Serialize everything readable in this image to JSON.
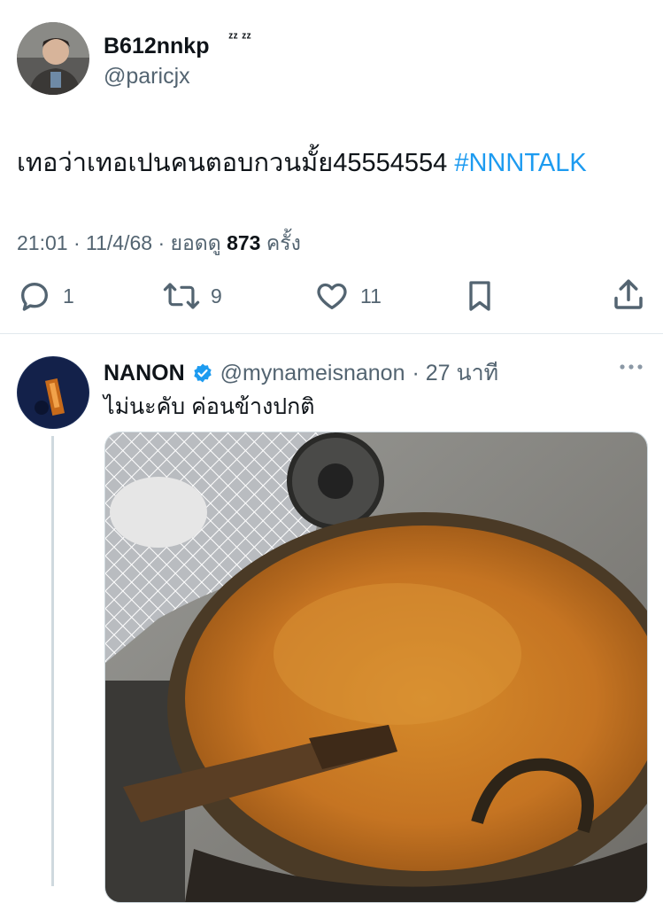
{
  "tweet": {
    "author_name": "B612nnkp",
    "author_badge": "ᶻᶻ ᶻᶻ",
    "handle": "@paricjx",
    "text_main": "เทอว่าเทอเปนคนตอบกวนมั้ย45554554",
    "hashtag": "#NNNTALK",
    "time": "21:01",
    "date": "11/4/68",
    "views_label": "ยอดดู",
    "views_count": "873",
    "views_unit": "ครั้ง",
    "dot": "·"
  },
  "actions": {
    "reply_icon": "reply-icon",
    "reply_count": "1",
    "retweet_icon": "retweet-icon",
    "retweet_count": "9",
    "like_icon": "heart-icon",
    "like_count": "11",
    "bookmark_icon": "bookmark-icon",
    "share_icon": "share-icon"
  },
  "reply": {
    "author_name": "NANON",
    "verified_icon": "verified-badge-icon",
    "handle": "@mynameisnanon",
    "time": "· 27 นาที",
    "text": "ไม่นะคับ ค่อนข้างปกติ",
    "more_icon": "more-icon",
    "media_description": "photo"
  },
  "colors": {
    "accent": "#1d9bf0",
    "secondary_text": "#536471",
    "primary_text": "#0f1419"
  }
}
